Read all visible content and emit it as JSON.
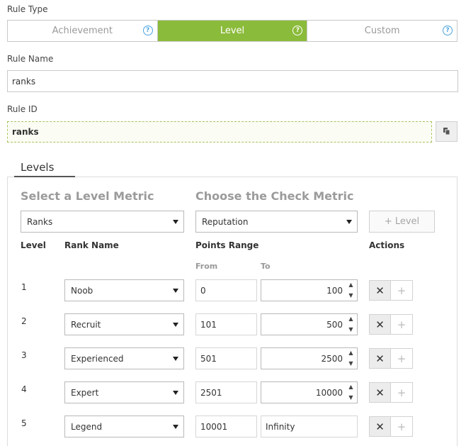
{
  "rule_type": {
    "label": "Rule Type",
    "options": [
      {
        "label": "Achievement",
        "active": false
      },
      {
        "label": "Level",
        "active": true
      },
      {
        "label": "Custom",
        "active": false
      }
    ],
    "help_glyph": "?",
    "accent": "#8bbb3b"
  },
  "rule_name": {
    "label": "Rule Name",
    "value": "ranks"
  },
  "rule_id": {
    "label": "Rule ID",
    "value": "ranks"
  },
  "tabs": {
    "levels": "Levels"
  },
  "levels_panel": {
    "select_level_metric": "Select a Level Metric",
    "choose_check_metric": "Choose the Check Metric",
    "level_metric_value": "Ranks",
    "check_metric_value": "Reputation",
    "add_level_label": "+ Level",
    "columns": {
      "level": "Level",
      "rank_name": "Rank Name",
      "points_range": "Points Range",
      "actions": "Actions",
      "from": "From",
      "to": "To"
    },
    "rows": [
      {
        "level": "1",
        "rank": "Noob",
        "from": "0",
        "to": "100"
      },
      {
        "level": "2",
        "rank": "Recruit",
        "from": "101",
        "to": "500"
      },
      {
        "level": "3",
        "rank": "Experienced",
        "from": "501",
        "to": "2500"
      },
      {
        "level": "4",
        "rank": "Expert",
        "from": "2501",
        "to": "10000"
      },
      {
        "level": "5",
        "rank": "Legend",
        "from": "10001",
        "to": "Infinity"
      }
    ],
    "remove_glyph": "✕",
    "add_glyph": "+"
  }
}
